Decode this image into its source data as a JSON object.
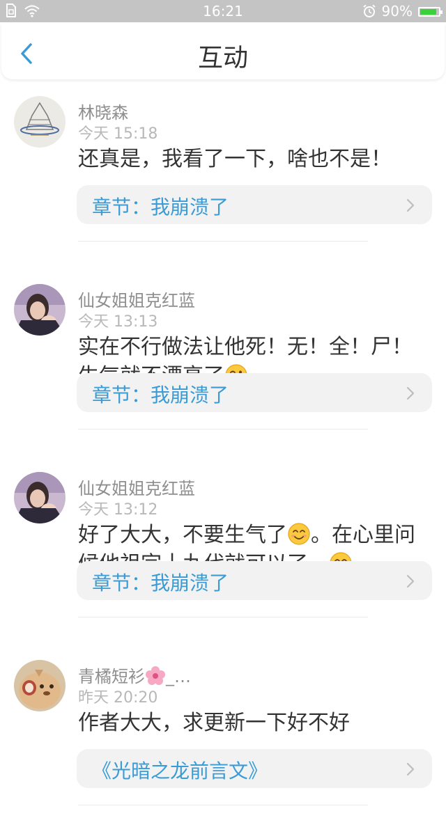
{
  "status_bar": {
    "time": "16:21",
    "battery": "90%",
    "battery_level": 0.9
  },
  "nav": {
    "title": "互动"
  },
  "comments": [
    {
      "user": "林晓森",
      "time": "今天  15:18",
      "text": "还真是，我看了一下，啥也不是！",
      "chapter": "章节：我崩溃了"
    },
    {
      "user": "仙女姐姐克红蓝",
      "time": "今天  13:13",
      "text_a": "实在不行做法让他死！无！全！尸！生气就不漂亮了",
      "chapter": "章节：我崩溃了"
    },
    {
      "user": "仙女姐姐克红蓝",
      "time": "今天  13:12",
      "text_a": "好了大大，不要生气了",
      "text_b": "。在心里问候他祖宗十九代就可以了。",
      "chapter": "章节：我崩溃了"
    },
    {
      "user": "青橘短衫",
      "user_suffix": "_…",
      "time": "昨天  20:20",
      "text": "作者大大，求更新一下好不好",
      "chapter": "《光暗之龙前言文》"
    }
  ],
  "colors": {
    "accent": "#3a9bd5",
    "status_bar": "#c4c4c4",
    "chapter_bg": "#f2f2f2",
    "battery": "#3ad13a"
  },
  "icons": [
    "sim-icon",
    "wifi-icon",
    "alarm-icon",
    "battery-icon",
    "back-icon",
    "chevron-right-icon",
    "wink-emoji-icon",
    "smile-emoji-icon",
    "flower-emoji-icon"
  ]
}
